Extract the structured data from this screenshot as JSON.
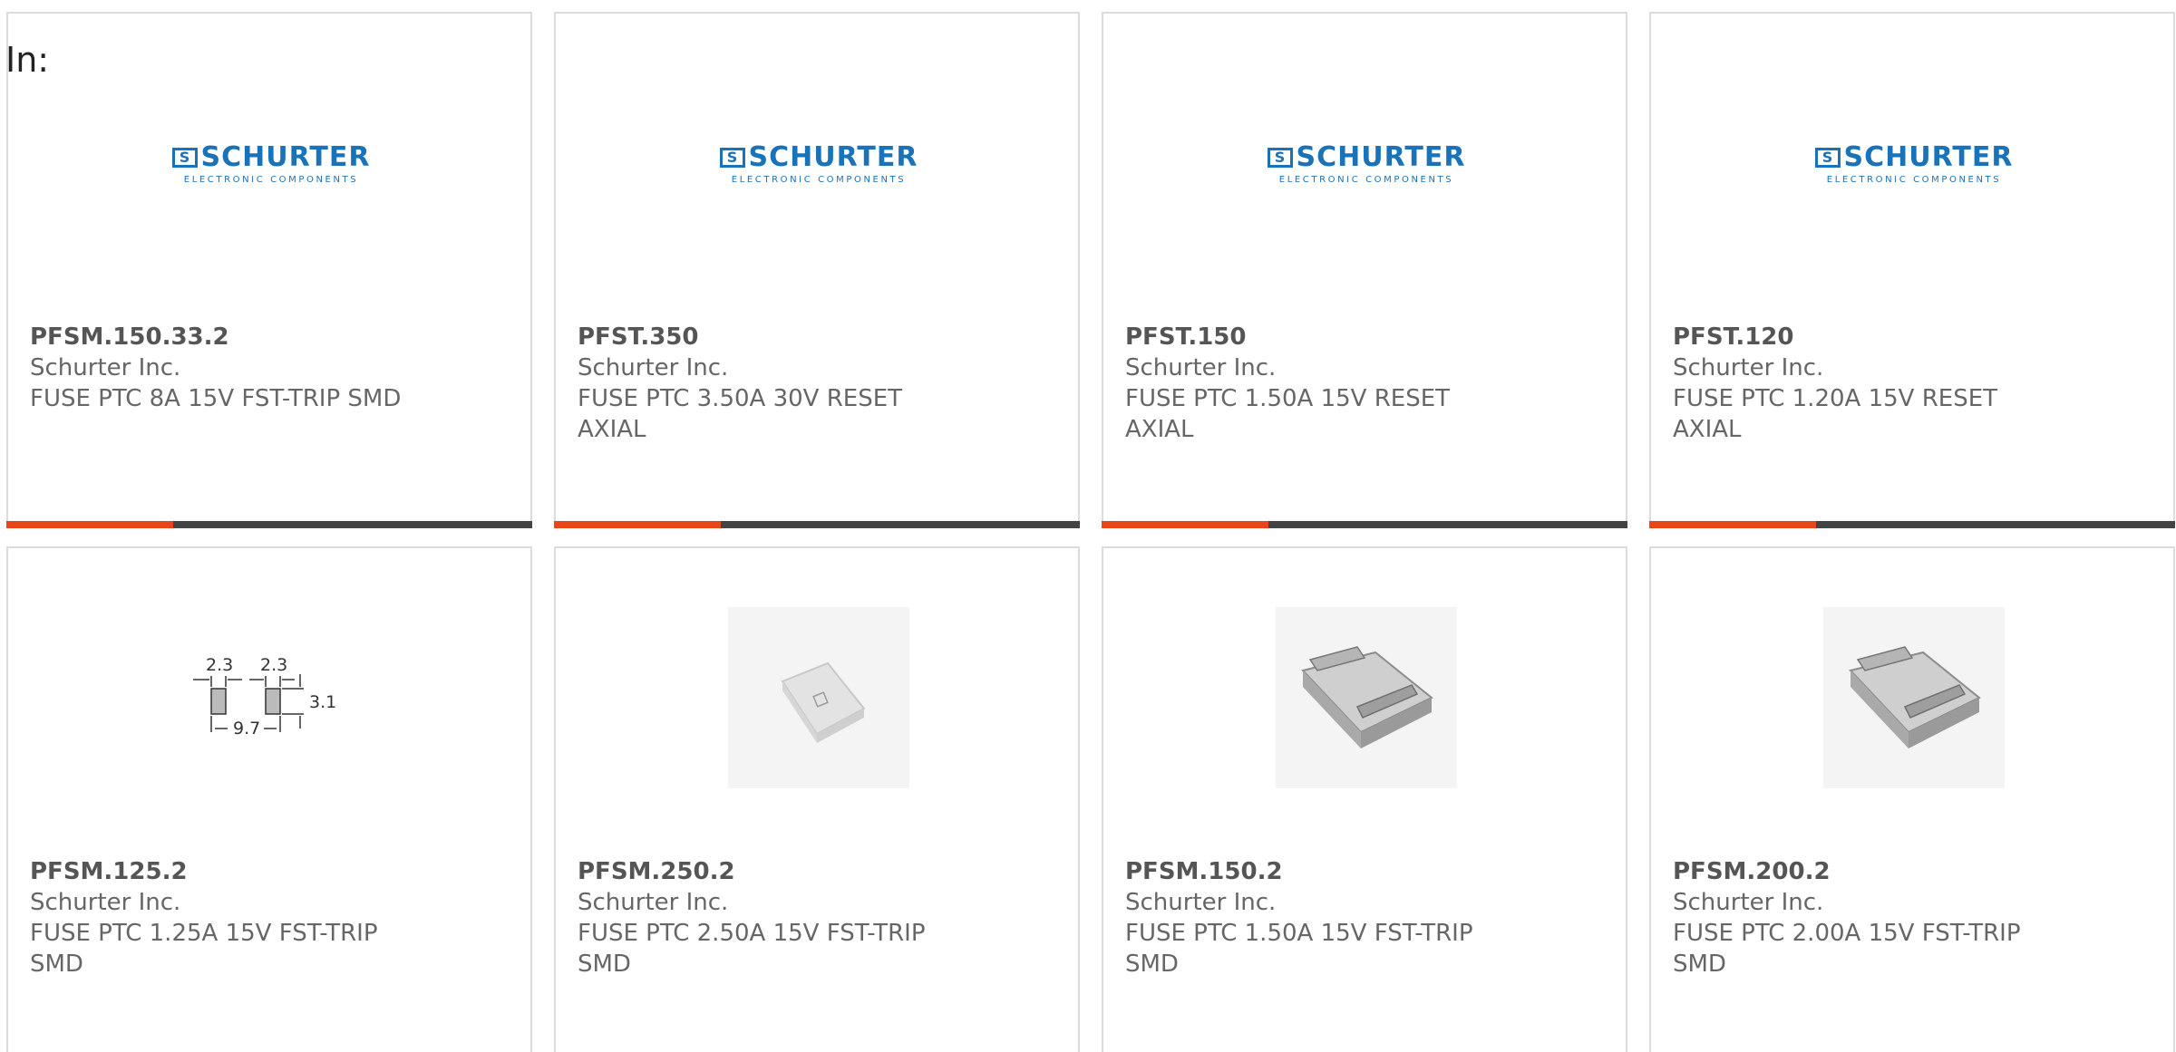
{
  "filter": {
    "label": "In:"
  },
  "logo": {
    "word": "SCHURTER",
    "sub": "ELECTRONIC COMPONENTS",
    "mark": "S"
  },
  "colors": {
    "accent": "#e8451b",
    "bar": "#444444",
    "brand": "#1a72b8"
  },
  "products": [
    {
      "part": "PFSM.150.33.2",
      "mfr": "Schurter Inc.",
      "desc": "FUSE PTC 8A 15V FST-TRIP SMD",
      "image": "schurter-logo"
    },
    {
      "part": "PFST.350",
      "mfr": "Schurter Inc.",
      "desc": "FUSE PTC 3.50A 30V RESET AXIAL",
      "image": "schurter-logo"
    },
    {
      "part": "PFST.150",
      "mfr": "Schurter Inc.",
      "desc": "FUSE PTC 1.50A 15V RESET AXIAL",
      "image": "schurter-logo"
    },
    {
      "part": "PFST.120",
      "mfr": "Schurter Inc.",
      "desc": "FUSE PTC 1.20A 15V RESET AXIAL",
      "image": "schurter-logo"
    },
    {
      "part": "PFSM.125.2",
      "mfr": "Schurter Inc.",
      "desc": "FUSE PTC 1.25A 15V FST-TRIP SMD",
      "image": "footprint-diagram"
    },
    {
      "part": "PFSM.250.2",
      "mfr": "Schurter Inc.",
      "desc": "FUSE PTC 2.50A 15V FST-TRIP SMD",
      "image": "smd-chip-photo"
    },
    {
      "part": "PFSM.150.2",
      "mfr": "Schurter Inc.",
      "desc": "FUSE PTC 1.50A 15V FST-TRIP SMD",
      "image": "smd-clip-photo"
    },
    {
      "part": "PFSM.200.2",
      "mfr": "Schurter Inc.",
      "desc": "FUSE PTC 2.00A 15V FST-TRIP SMD",
      "image": "smd-clip-photo"
    }
  ],
  "footprint": {
    "pad_w": "2.3",
    "pad_w2": "2.3",
    "height": "3.1",
    "pitch": "9.7"
  }
}
